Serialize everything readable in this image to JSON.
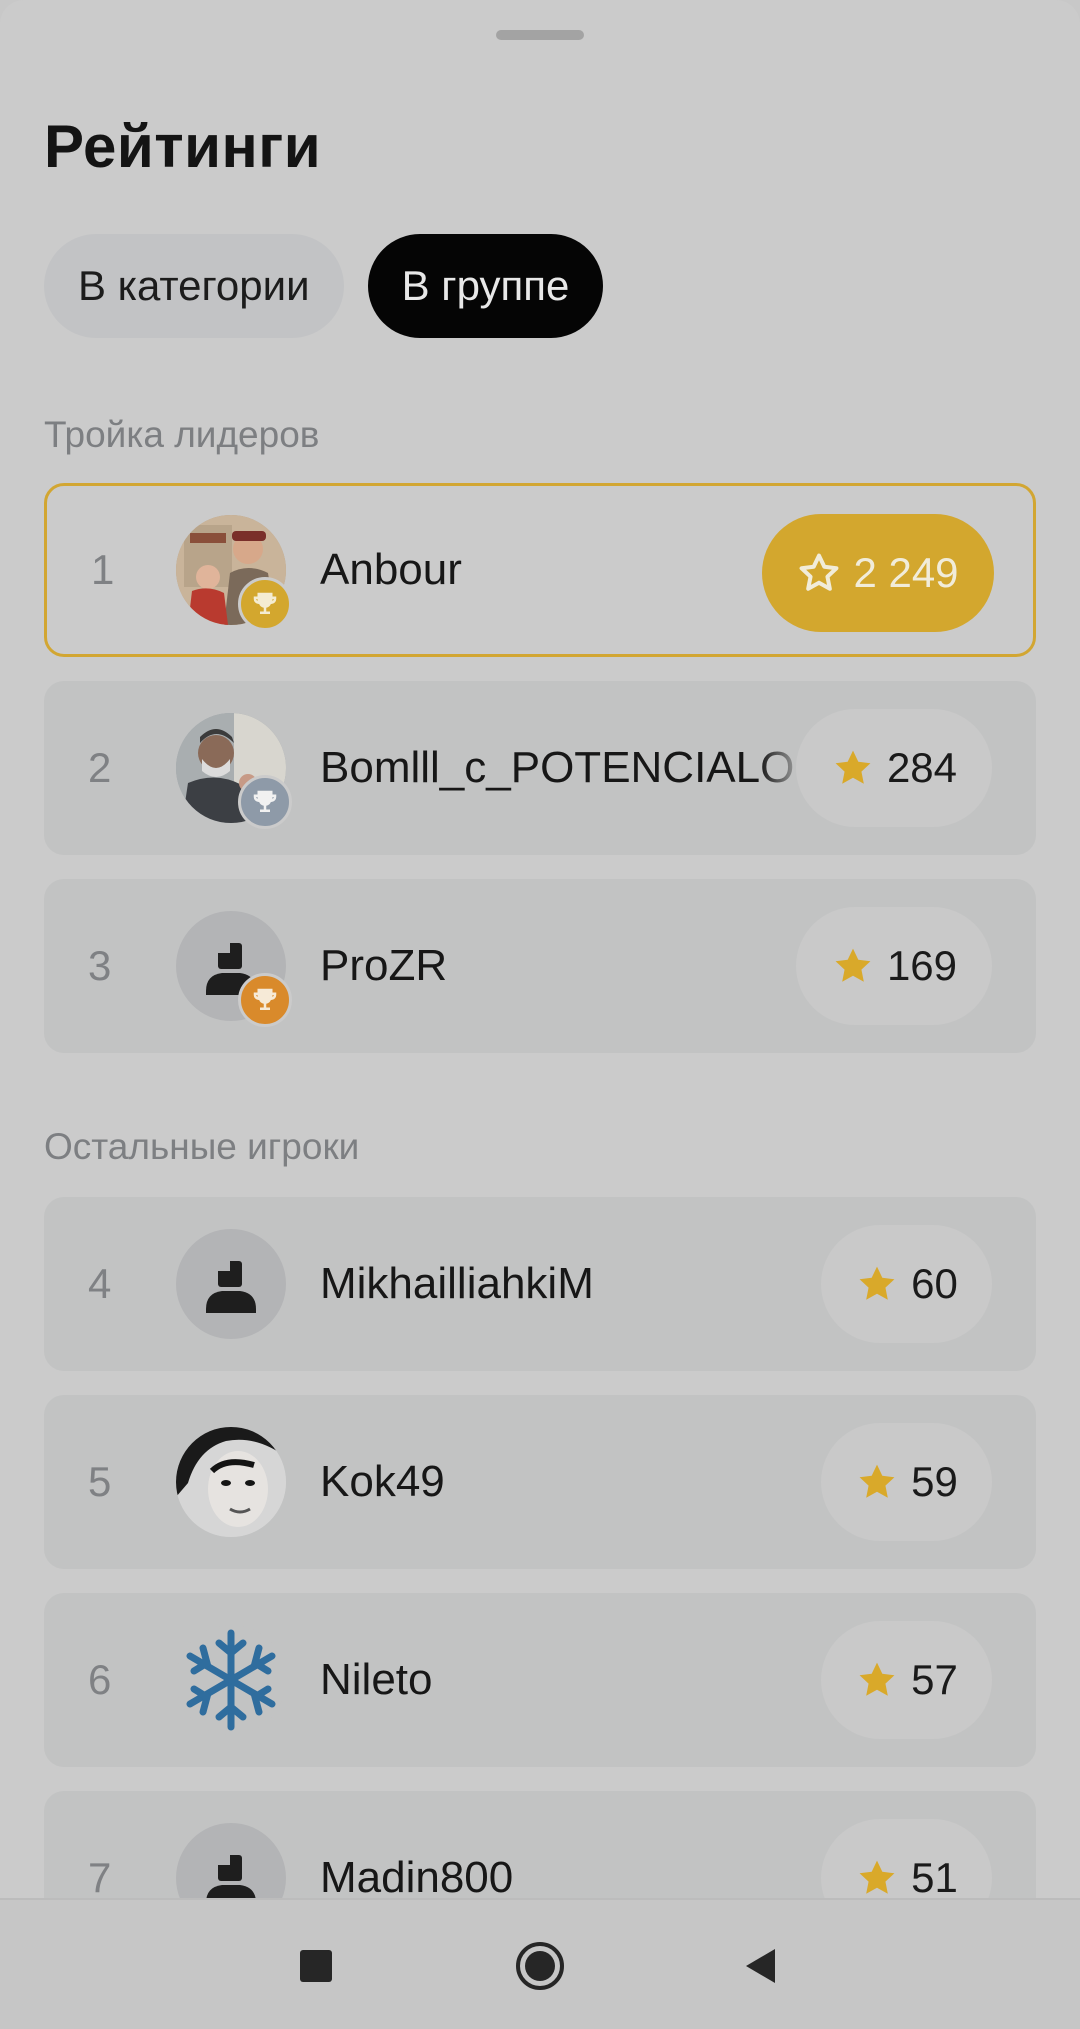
{
  "title": "Рейтинги",
  "tabs": [
    {
      "label": "В категории",
      "active": false
    },
    {
      "label": "В группе",
      "active": true
    }
  ],
  "sections": {
    "leaders_label": "Тройка лидеров",
    "others_label": "Остальные игроки"
  },
  "players": [
    {
      "rank": "1",
      "name": "Anbour",
      "score": "2 249",
      "trophy": "gold",
      "avatar": "photo-couple"
    },
    {
      "rank": "2",
      "name": "Bomlll_c_POTENCIALO",
      "score": "284",
      "trophy": "silver",
      "avatar": "photo-man"
    },
    {
      "rank": "3",
      "name": "ProZR",
      "score": "169",
      "trophy": "bronze",
      "avatar": "default-user-icon"
    },
    {
      "rank": "4",
      "name": "MikhailliahkiM",
      "score": "60",
      "trophy": "",
      "avatar": "default-user-icon"
    },
    {
      "rank": "5",
      "name": "Kok49",
      "score": "59",
      "trophy": "",
      "avatar": "photo-woman-bw"
    },
    {
      "rank": "6",
      "name": "Nileto",
      "score": "57",
      "trophy": "",
      "avatar": "snowflake-icon"
    },
    {
      "rank": "7",
      "name": "Madin800",
      "score": "51",
      "trophy": "",
      "avatar": "default-user-icon"
    }
  ],
  "colors": {
    "accent_gold": "#d3a72e",
    "trophy_silver": "#8e9aa8",
    "trophy_bronze": "#d98a2b",
    "star": "#d9a92a"
  },
  "navbar": [
    "recents-icon",
    "home-icon",
    "back-icon"
  ]
}
